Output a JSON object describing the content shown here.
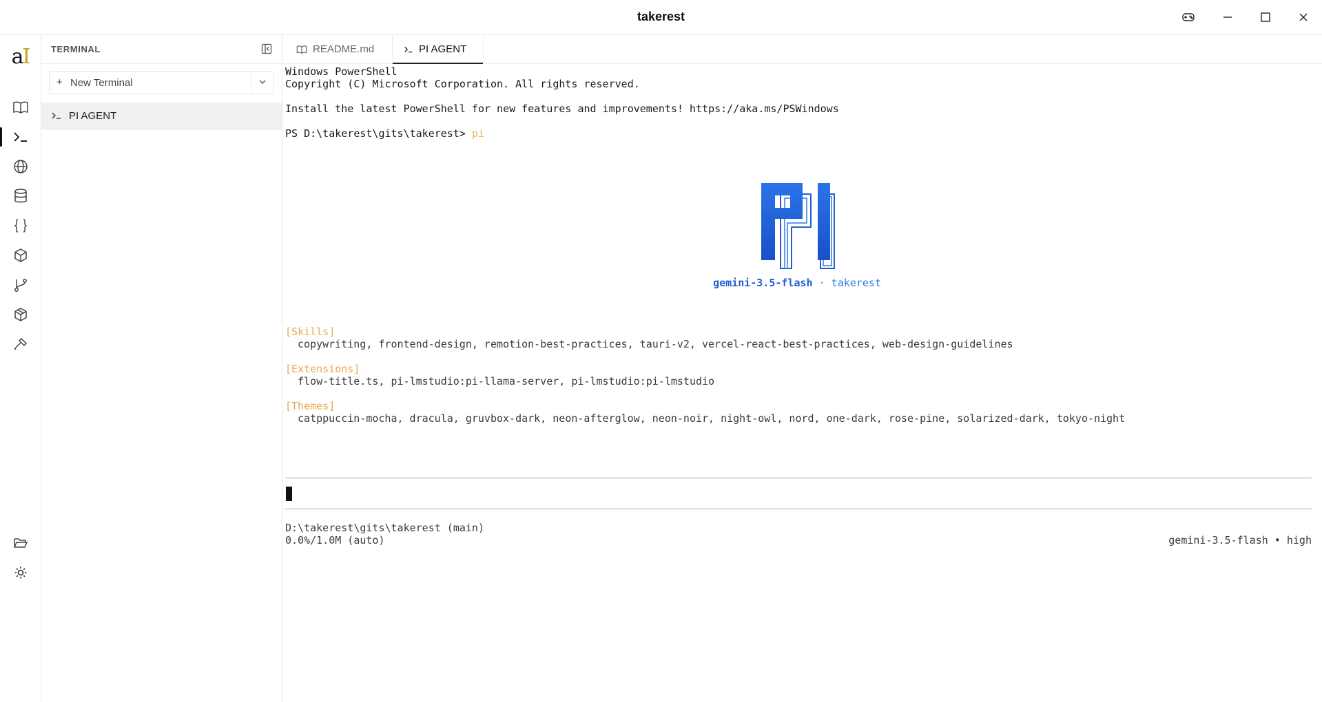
{
  "window": {
    "title": "takerest"
  },
  "logo": {
    "text": "aI"
  },
  "sidebar": {
    "title": "TERMINAL",
    "new_terminal_label": "New Terminal",
    "items": [
      {
        "label": "PI AGENT"
      }
    ]
  },
  "tabs": [
    {
      "label": "README.md",
      "icon": "book-icon"
    },
    {
      "label": "PI AGENT",
      "icon": "terminal-prompt-icon",
      "active": true
    }
  ],
  "terminal": {
    "line1": "Windows PowerShell",
    "line2": "Copyright (C) Microsoft Corporation. All rights reserved.",
    "line3": "Install the latest PowerShell for new features and improvements! https://aka.ms/PSWindows",
    "prompt": "PS D:\\takerest\\gits\\takerest> ",
    "command": "pi",
    "model": "gemini-3.5-flash",
    "model_separator": " · ",
    "project": "takerest",
    "skills_header": "[Skills]",
    "skills": "copywriting, frontend-design, remotion-best-practices, tauri-v2, vercel-react-best-practices, web-design-guidelines",
    "extensions_header": "[Extensions]",
    "extensions": "flow-title.ts, pi-lmstudio:pi-llama-server, pi-lmstudio:pi-lmstudio",
    "themes_header": "[Themes]",
    "themes": "catppuccin-mocha, dracula, gruvbox-dark, neon-afterglow, neon-noir, night-owl, nord, one-dark, rose-pine, solarized-dark, tokyo-night",
    "cwd_status": "D:\\takerest\\gits\\takerest (main)",
    "context_status": "0.0%/1.0M (auto)",
    "model_status": "gemini-3.5-flash • high"
  },
  "icons": {
    "activity": [
      "book-icon",
      "terminal-icon",
      "globe-icon",
      "database-icon",
      "braces-icon",
      "cube-icon",
      "git-branch-icon",
      "package-icon",
      "hammer-icon",
      "folder-open-icon",
      "sun-icon"
    ],
    "window": [
      "gamepad-icon",
      "minimize-icon",
      "maximize-icon",
      "close-icon"
    ]
  },
  "colors": {
    "pi_logo_blue": "#1f5ed6",
    "section_header": "#e8a84c",
    "input_border": "#c98bc4"
  }
}
